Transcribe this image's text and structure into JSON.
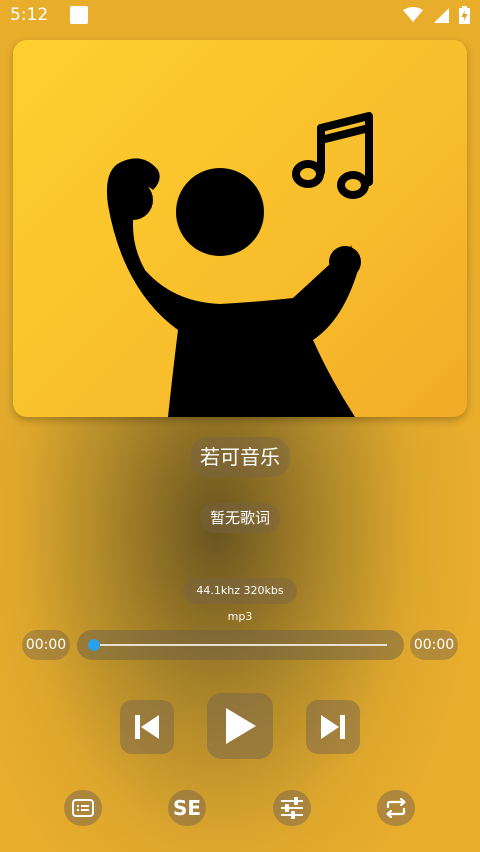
{
  "status_bar": {
    "time": "5:12",
    "icons": [
      "notification-square-icon",
      "wifi-icon",
      "signal-icon",
      "battery-charging-icon"
    ]
  },
  "album_cover": {
    "icon": "dancing-person-music-note-logo",
    "background": "#fbc52e"
  },
  "track": {
    "title": "若可音乐",
    "lyrics_placeholder": "暂无歌词",
    "quality": "44.1khz 320kbs mp3"
  },
  "progress": {
    "current_time": "00:00",
    "total_time": "00:00",
    "fraction": 0.0,
    "accent_color": "#2aa0e8"
  },
  "controls": {
    "prev_icon": "skip-previous-icon",
    "play_icon": "play-icon",
    "next_icon": "skip-next-icon"
  },
  "toolbar": {
    "lyric_icon": "lyrics-list-icon",
    "se_label": "SE",
    "eq_icon": "equalizer-icon",
    "loop_icon": "repeat-icon"
  }
}
